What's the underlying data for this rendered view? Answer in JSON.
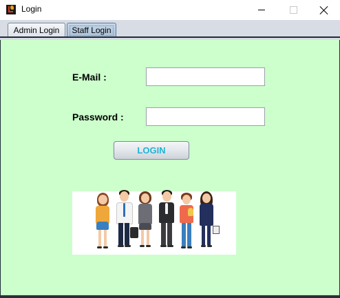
{
  "window": {
    "title": "Login",
    "icon": "java-app-icon",
    "controls": [
      "minimize-icon",
      "maximize-icon",
      "close-icon"
    ]
  },
  "tabs": [
    {
      "label": "Admin Login",
      "selected": false
    },
    {
      "label": "Staff Login",
      "selected": true
    }
  ],
  "form": {
    "email_label": "E-Mail :",
    "email_value": "",
    "password_label": "Password :",
    "password_value": "",
    "login_label": "LOGIN"
  },
  "illustration": {
    "name": "group-of-people-image",
    "people_count": 6
  },
  "colors": {
    "panel_background": "#ccffcc",
    "login_text": "#1fb3d6",
    "tab_selected": "#a9c1d9"
  }
}
